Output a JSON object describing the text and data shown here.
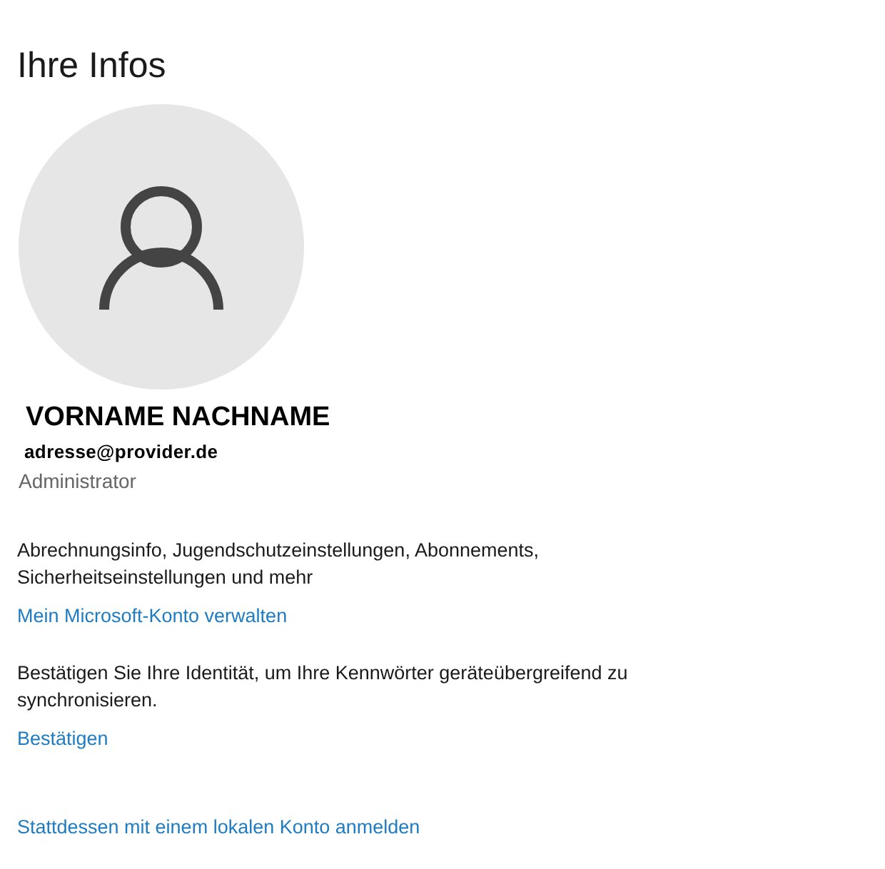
{
  "page_title": "Ihre Infos",
  "profile": {
    "name": "VORNAME NACHNAME",
    "email": "adresse@provider.de",
    "role": "Administrator"
  },
  "sections": [
    {
      "description": "Abrechnungsinfo, Jugendschutzeinstellungen, Abonnements, Sicherheitseinstellungen und mehr",
      "link": "Mein Microsoft-Konto verwalten"
    },
    {
      "description": "Bestätigen Sie Ihre Identität, um Ihre Kennwörter geräteübergreifend zu synchronisieren.",
      "link": "Bestätigen"
    }
  ],
  "footer_link": "Stattdessen mit einem lokalen Konto anmelden"
}
